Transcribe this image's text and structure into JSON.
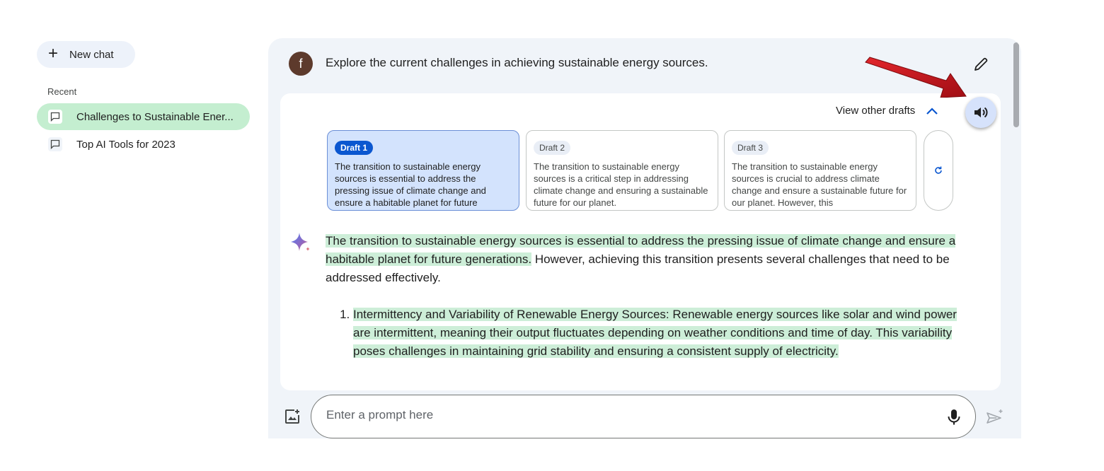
{
  "sidebar": {
    "new_chat_label": "New chat",
    "recent_label": "Recent",
    "chats": [
      {
        "label": "Challenges to Sustainable Ener..."
      },
      {
        "label": "Top AI Tools for 2023"
      }
    ]
  },
  "conversation": {
    "user_avatar_letter": "f",
    "user_prompt": "Explore the current challenges in achieving sustainable energy sources.",
    "view_drafts_label": "View other drafts",
    "drafts": [
      {
        "label": "Draft 1",
        "text": "The transition to sustainable energy sources is essential to address the pressing issue of climate change and ensure a habitable planet for future generations."
      },
      {
        "label": "Draft 2",
        "text": "The transition to sustainable energy sources is a critical step in addressing climate change and ensuring a sustainable future for our planet."
      },
      {
        "label": "Draft 3",
        "text": "The transition to sustainable energy sources is crucial to address climate change and ensure a sustainable future for our planet. However, this"
      }
    ],
    "response": {
      "intro_highlighted": "The transition to sustainable energy sources is essential to address the pressing issue of climate change and ensure a habitable planet for future generations.",
      "intro_rest": " However, achieving this transition presents several challenges that need to be addressed effectively.",
      "list": [
        {
          "title": "Intermittency and Variability of Renewable Energy Sources:",
          "text1": " Renewable energy sources like solar and wind power are intermittent, meaning their output fluctuates depending on weather conditions and time of day.",
          "text2": " This variability poses challenges in maintaining grid stability and ensuring a consistent supply of electricity."
        }
      ]
    }
  },
  "input": {
    "placeholder": "Enter a prompt here"
  },
  "colors": {
    "active_chat": "#c4eed0",
    "highlight": "#cdeed8",
    "draft_selected": "#d3e3fd",
    "brand_blue": "#0b57d0",
    "annotation_arrow": "#c8161d"
  },
  "icons": [
    "plus-icon",
    "chat-bubble-icon",
    "pencil-icon",
    "chevron-up-icon",
    "refresh-icon",
    "gemini-sparkle-icon",
    "speaker-icon",
    "image-add-icon",
    "mic-icon",
    "send-icon"
  ]
}
